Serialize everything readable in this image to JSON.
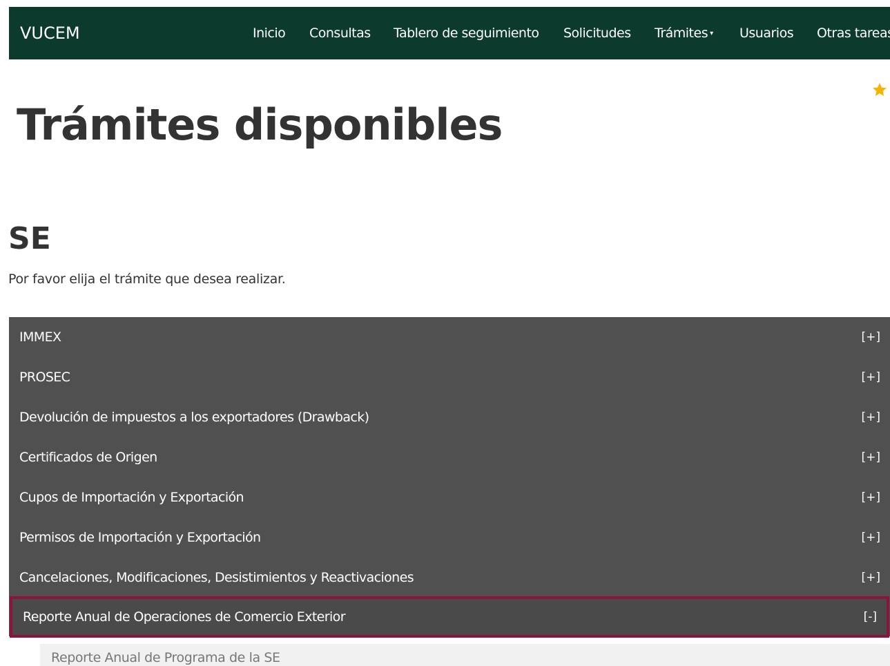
{
  "navbar": {
    "brand": "VUCEM",
    "items": [
      {
        "label": "Inicio"
      },
      {
        "label": "Consultas"
      },
      {
        "label": "Tablero de seguimiento"
      },
      {
        "label": "Solicitudes"
      },
      {
        "label": "Trámites",
        "has_dropdown": true
      },
      {
        "label": "Usuarios"
      },
      {
        "label": "Otras tareas"
      }
    ],
    "color": "#0c3b2e"
  },
  "favorite_icon": "star-icon",
  "page_title": "Trámites disponibles",
  "section": {
    "title": "SE",
    "instructions": "Por favor elija el trámite que desea realizar."
  },
  "accordion": {
    "items": [
      {
        "label": "IMMEX",
        "toggle": "[+]"
      },
      {
        "label": "PROSEC",
        "toggle": "[+]"
      },
      {
        "label": "Devolución de impuestos a los exportadores (Drawback)",
        "toggle": "[+]"
      },
      {
        "label": "Certificados de Origen",
        "toggle": "[+]"
      },
      {
        "label": "Cupos de Importación y Exportación",
        "toggle": "[+]"
      },
      {
        "label": "Permisos de Importación y Exportación",
        "toggle": "[+]"
      },
      {
        "label": "Cancelaciones, Modificaciones, Desistimientos y Reactivaciones",
        "toggle": "[+]"
      },
      {
        "label": "Reporte Anual de Operaciones de Comercio Exterior",
        "toggle": "[-]",
        "expanded": true
      }
    ],
    "expanded_children": [
      {
        "label": "Reporte Anual de Programa de la SE"
      }
    ],
    "highlight_color": "#8a1538",
    "background_color": "#505050"
  }
}
